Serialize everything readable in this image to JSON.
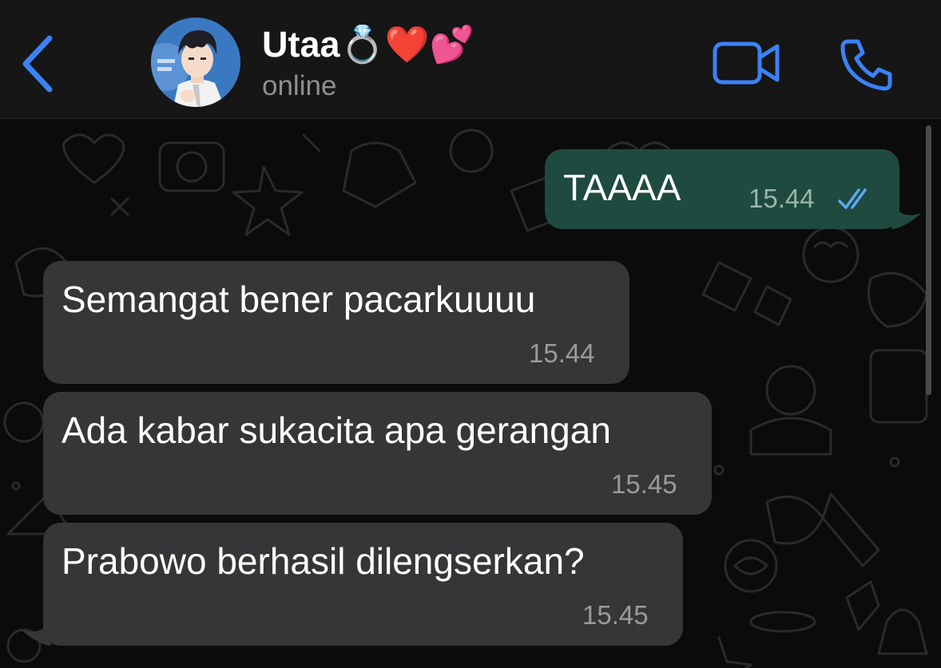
{
  "header": {
    "contact_name": "Utaa💍❤️💕",
    "status": "online"
  },
  "icons": {
    "back": "chevron-left-icon",
    "video": "video-camera-icon",
    "call": "phone-icon",
    "read_receipt": "double-check-icon"
  },
  "colors": {
    "accent": "#3b82f6",
    "outgoing_bubble": "#1f4a3f",
    "incoming_bubble": "#363638",
    "read_tick": "#5aa9f5"
  },
  "messages": [
    {
      "direction": "outgoing",
      "text": "TAAAA",
      "time": "15.44",
      "status": "read"
    },
    {
      "direction": "incoming",
      "text": "Semangat bener pacarkuuuu",
      "time": "15.44"
    },
    {
      "direction": "incoming",
      "text": "Ada kabar sukacita apa gerangan",
      "time": "15.45"
    },
    {
      "direction": "incoming",
      "text": "Prabowo berhasil dilengserkan?",
      "time": "15.45"
    }
  ]
}
